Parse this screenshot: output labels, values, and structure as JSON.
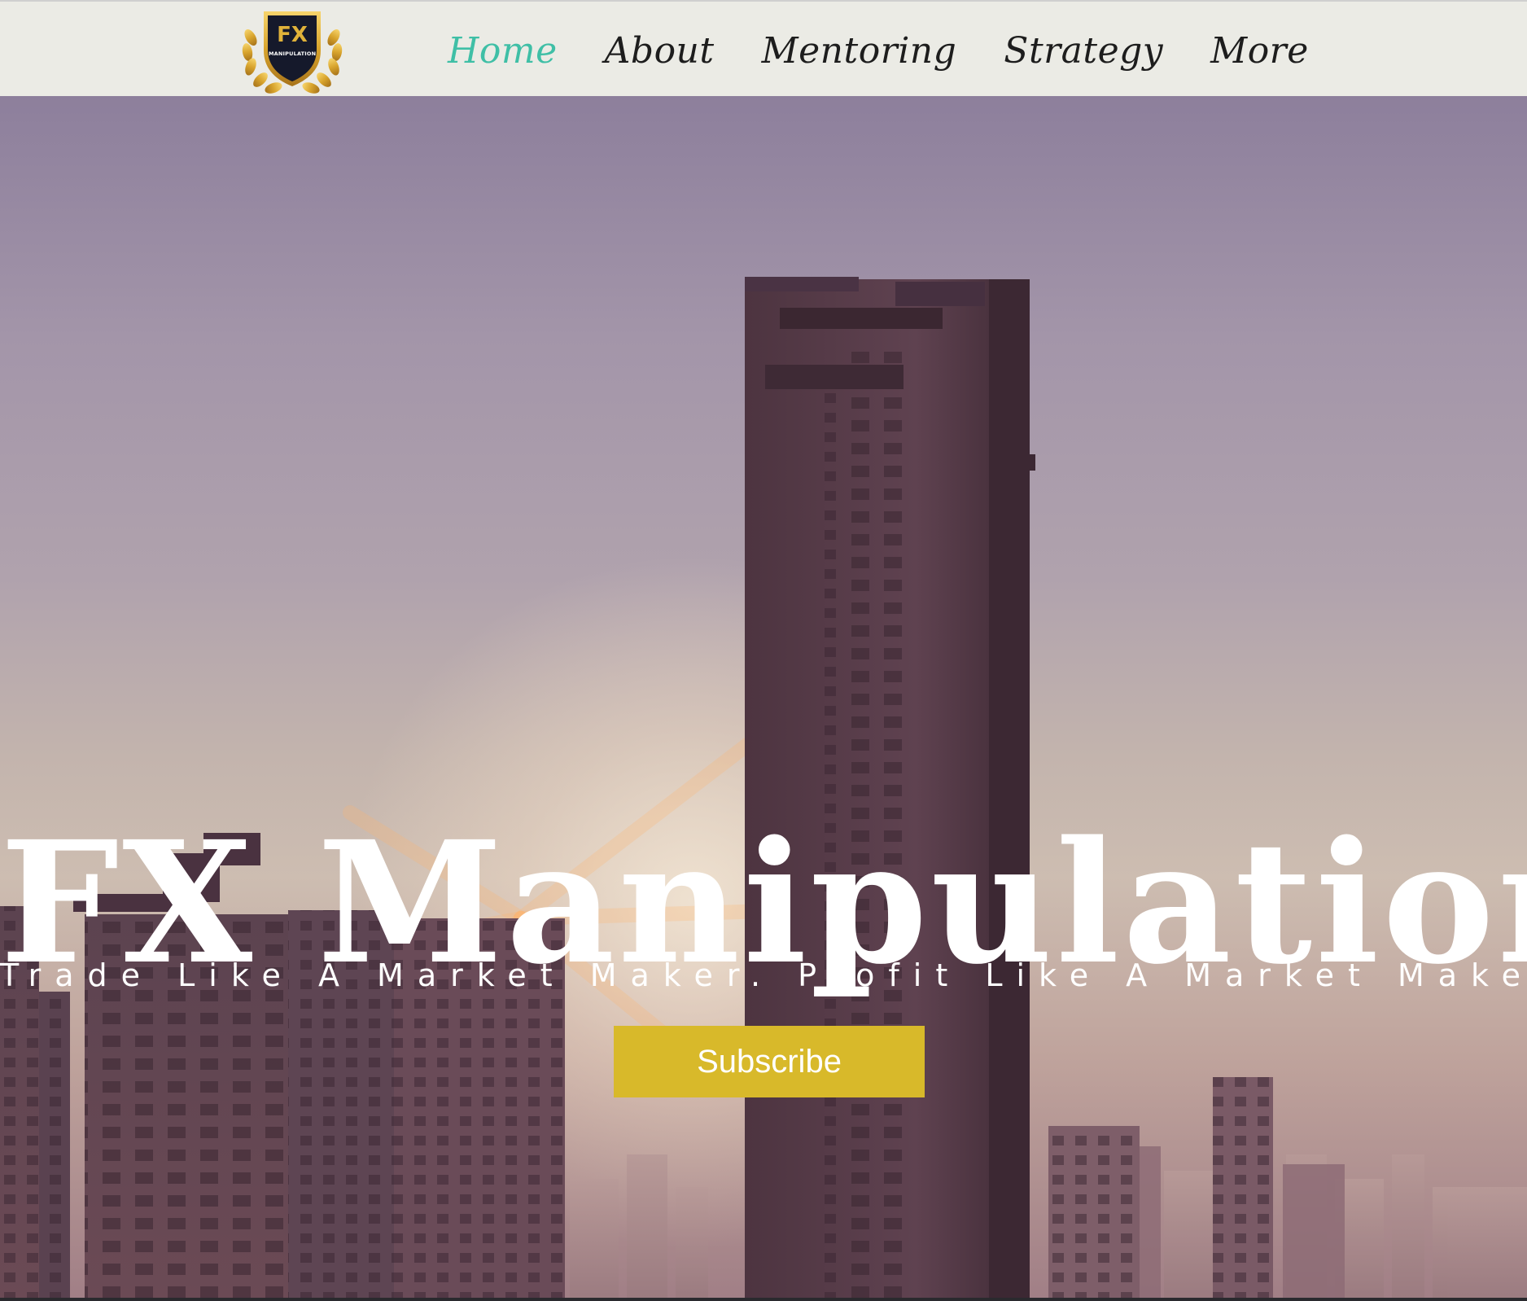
{
  "brand": {
    "logo_text_main": "FX",
    "logo_text_sub": "MANIPULATION"
  },
  "nav": {
    "items": [
      {
        "label": "Home",
        "active": true
      },
      {
        "label": "About",
        "active": false
      },
      {
        "label": "Mentoring",
        "active": false
      },
      {
        "label": "Strategy",
        "active": false
      },
      {
        "label": "More",
        "active": false
      }
    ]
  },
  "hero": {
    "title": "FX Manipulation",
    "subtitle": "Trade Like A Market Maker. Profit Like A Market Maker.",
    "cta_label": "Subscribe"
  },
  "colors": {
    "nav_active": "#3fbfa6",
    "nav_text": "#1d1d1d",
    "header_bg": "#ebebe5",
    "cta_bg": "#d8b92a",
    "hero_text": "#ffffff"
  },
  "icons": {
    "logo": "fx-manipulation-shield-logo"
  }
}
